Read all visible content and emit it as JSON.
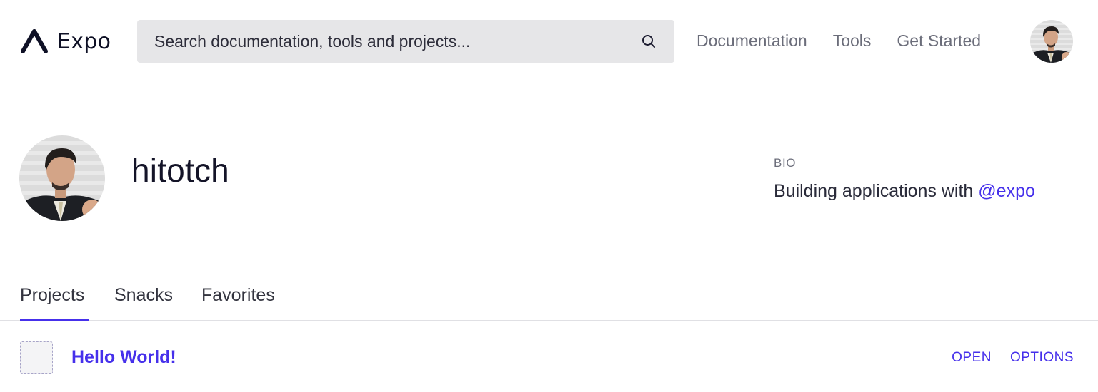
{
  "header": {
    "logo_text": "Expo",
    "search": {
      "placeholder": "Search documentation, tools and projects...",
      "value": ""
    },
    "nav": [
      {
        "label": "Documentation"
      },
      {
        "label": "Tools"
      },
      {
        "label": "Get Started"
      }
    ]
  },
  "profile": {
    "username": "hitotch",
    "bio_label": "BIO",
    "bio_text": "Building applications with ",
    "bio_link": "@expo"
  },
  "tabs": [
    {
      "label": "Projects",
      "active": true
    },
    {
      "label": "Snacks",
      "active": false
    },
    {
      "label": "Favorites",
      "active": false
    }
  ],
  "projects": [
    {
      "name": "Hello World!",
      "open_label": "OPEN",
      "options_label": "OPTIONS"
    }
  ],
  "colors": {
    "accent": "#4630eb",
    "search_bg": "#e6e6e8",
    "nav_text": "#6b6d7a"
  },
  "icons": {
    "logo": "expo-logo-icon",
    "search": "search-icon"
  }
}
